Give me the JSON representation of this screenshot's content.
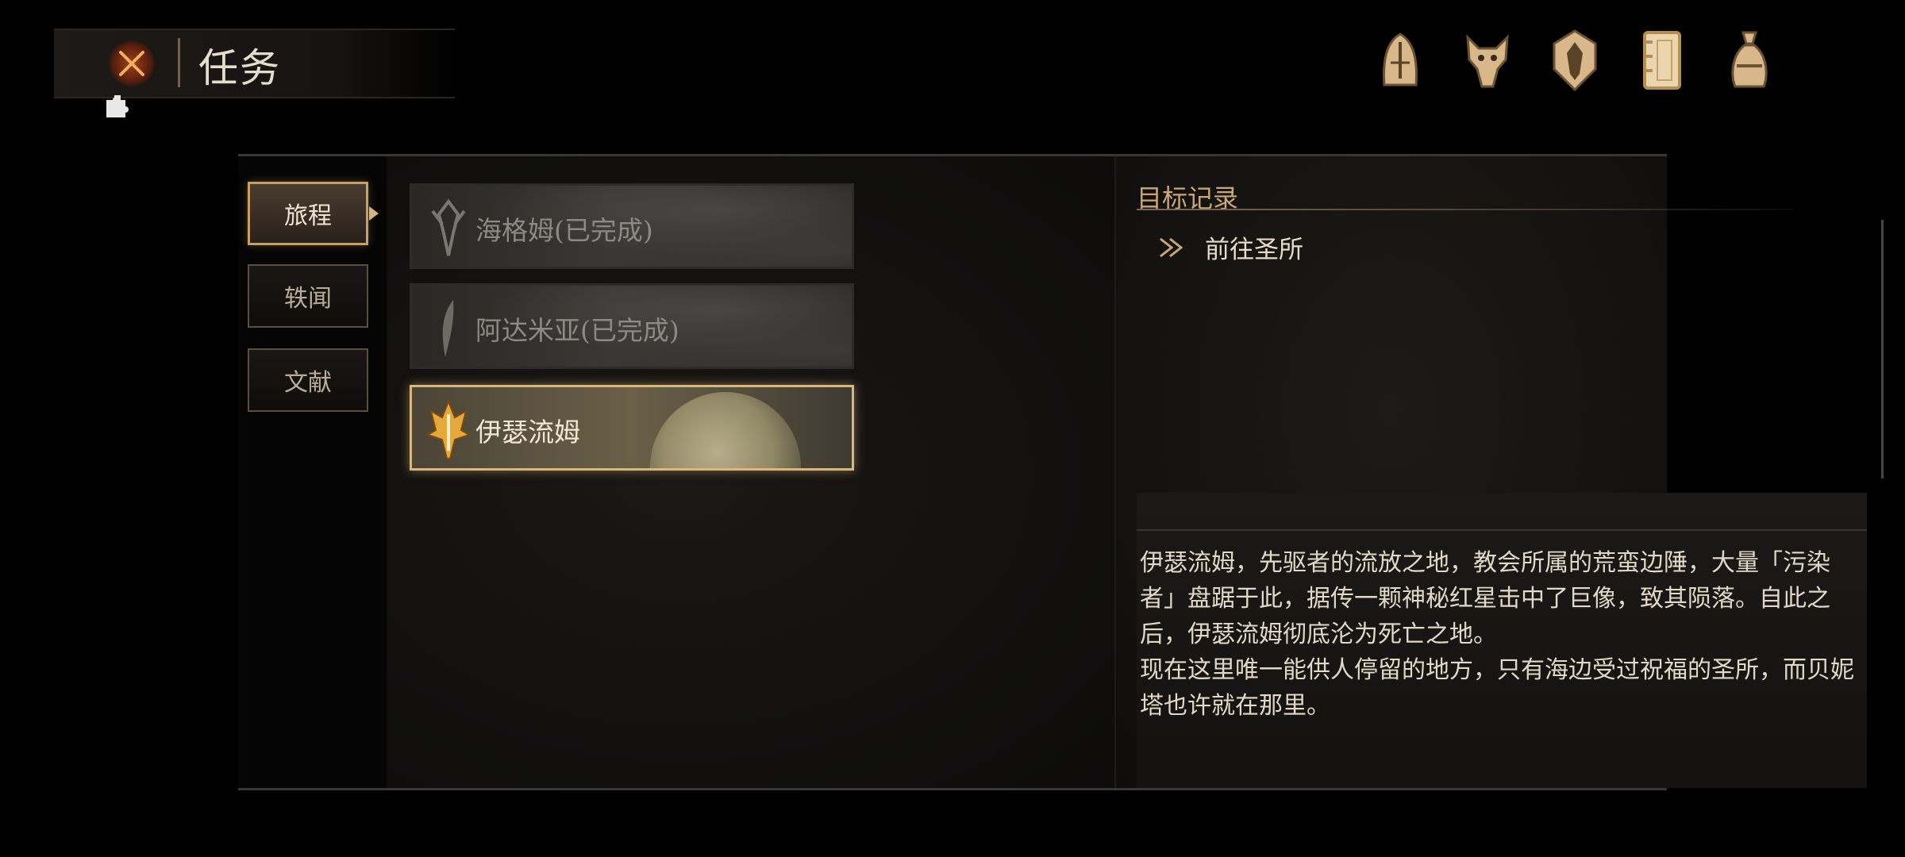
{
  "header": {
    "title": "任务",
    "close_icon": "close-x-icon",
    "puzzle_icon": "puzzle-icon"
  },
  "top_icons": [
    {
      "name": "helmet-icon"
    },
    {
      "name": "beast-skull-icon"
    },
    {
      "name": "shield-crest-icon"
    },
    {
      "name": "journal-icon"
    },
    {
      "name": "pouch-icon"
    }
  ],
  "side_tabs": [
    {
      "label": "旅程",
      "active": true
    },
    {
      "label": "轶闻",
      "active": false
    },
    {
      "label": "文献",
      "active": false
    }
  ],
  "quests": [
    {
      "label": "海格姆(已完成)",
      "active": false
    },
    {
      "label": "阿达米亚(已完成)",
      "active": false
    },
    {
      "label": "伊瑟流姆",
      "active": true
    }
  ],
  "objective": {
    "heading": "目标记录",
    "items": [
      {
        "text": "前往圣所"
      }
    ]
  },
  "description": {
    "paragraphs": [
      "伊瑟流姆，先驱者的流放之地，教会所属的荒蛮边陲，大量「污染者」盘踞于此，据传一颗神秘红星击中了巨像，致其陨落。自此之后，伊瑟流姆彻底沦为死亡之地。",
      "现在这里唯一能供人停留的地方，只有海边受过祝福的圣所，而贝妮塔也许就在那里。"
    ]
  },
  "colors": {
    "accent_gold": "#d9b77a",
    "text_light": "#e6dccb",
    "close_glow": "#a0401a"
  }
}
